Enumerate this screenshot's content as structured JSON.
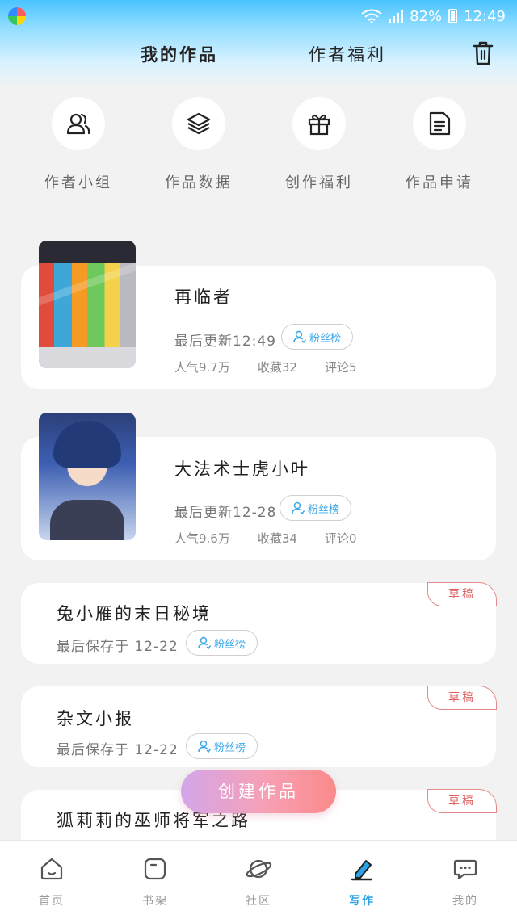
{
  "status_bar": {
    "battery": "82%",
    "time": "12:49"
  },
  "header": {
    "tabs": [
      {
        "label": "我的作品",
        "active": true
      },
      {
        "label": "作者福利",
        "active": false
      }
    ]
  },
  "quick_menu": [
    {
      "label": "作者小组",
      "icon": "group-icon"
    },
    {
      "label": "作品数据",
      "icon": "layers-icon"
    },
    {
      "label": "创作福利",
      "icon": "gift-icon"
    },
    {
      "label": "作品申请",
      "icon": "document-icon"
    }
  ],
  "published_works": [
    {
      "title": "再临者",
      "updated": "最后更新12:49",
      "fans_label": "粉丝榜",
      "popularity": "人气9.7万",
      "favorites": "收藏32",
      "comments": "评论5"
    },
    {
      "title": "大法术士虎小叶",
      "updated": "最后更新12-28",
      "fans_label": "粉丝榜",
      "popularity": "人气9.6万",
      "favorites": "收藏34",
      "comments": "评论0"
    }
  ],
  "drafts": [
    {
      "title": "兔小雁的末日秘境",
      "saved": "最后保存于 12-22",
      "fans_label": "粉丝榜",
      "tag": "草稿"
    },
    {
      "title": "杂文小报",
      "saved": "最后保存于 12-22",
      "fans_label": "粉丝榜",
      "tag": "草稿"
    },
    {
      "title": "狐莉莉的巫师将军之路",
      "tag": "草稿"
    }
  ],
  "fab": {
    "label": "创建作品"
  },
  "bottom_nav": [
    {
      "label": "首页",
      "icon": "home-icon",
      "active": false
    },
    {
      "label": "书架",
      "icon": "bookshelf-icon",
      "active": false
    },
    {
      "label": "社区",
      "icon": "planet-icon",
      "active": false
    },
    {
      "label": "写作",
      "icon": "pen-icon",
      "active": true
    },
    {
      "label": "我的",
      "icon": "chat-icon",
      "active": false
    }
  ],
  "colors": {
    "accent": "#2aa2e8",
    "draft": "#e06060",
    "fab_start": "#d3a6ea",
    "fab_end": "#fb8a8a"
  }
}
